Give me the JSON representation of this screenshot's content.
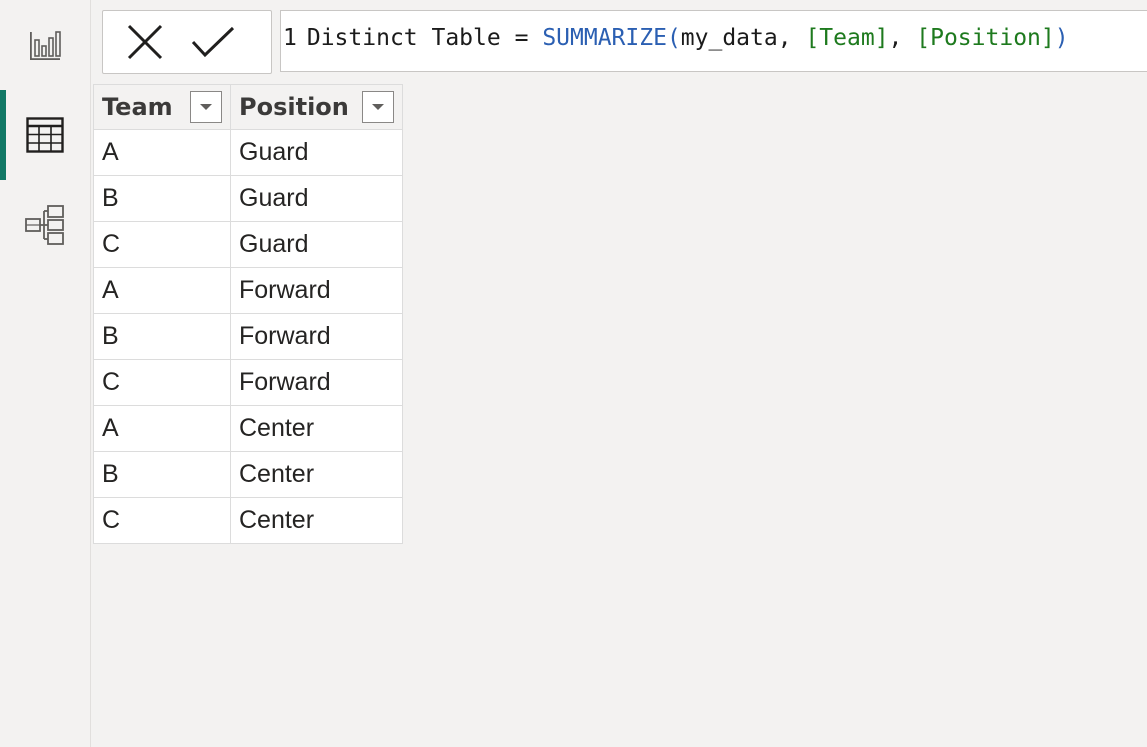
{
  "formula_bar": {
    "line_number": "1",
    "table_name": "Distinct Table",
    "operator": "=",
    "function": "SUMMARIZE",
    "open_paren": "(",
    "arg_table": "my_data",
    "sep1": ",",
    "arg_col1": "[Team]",
    "sep2": ",",
    "arg_col2": "[Position]",
    "close_paren": ")"
  },
  "rail": {
    "items": [
      {
        "icon": "report-view-icon"
      },
      {
        "icon": "table-view-icon",
        "active": true
      },
      {
        "icon": "model-view-icon"
      }
    ]
  },
  "table": {
    "columns": [
      "Team",
      "Position"
    ],
    "rows": [
      [
        "A",
        "Guard"
      ],
      [
        "B",
        "Guard"
      ],
      [
        "C",
        "Guard"
      ],
      [
        "A",
        "Forward"
      ],
      [
        "B",
        "Forward"
      ],
      [
        "C",
        "Forward"
      ],
      [
        "A",
        "Center"
      ],
      [
        "B",
        "Center"
      ],
      [
        "C",
        "Center"
      ]
    ]
  },
  "colors": {
    "accent": "#117865",
    "function_token": "#2b5fb2",
    "column_token": "#1e7a1e"
  }
}
